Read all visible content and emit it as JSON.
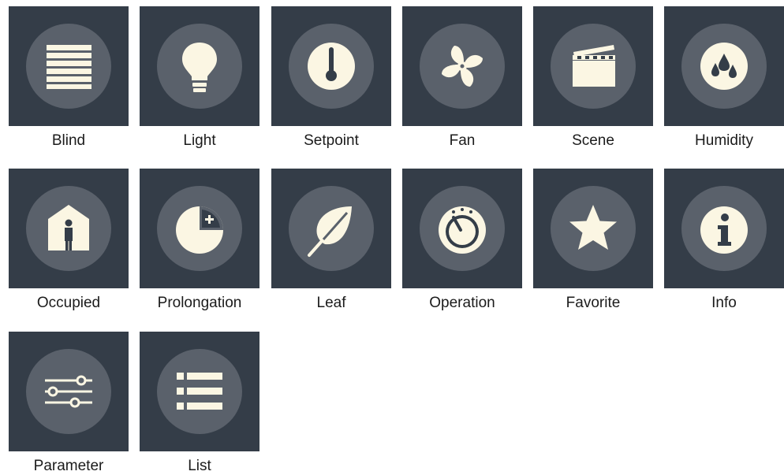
{
  "colors": {
    "tile_background": "#343d48",
    "circle_background": "#5a616b",
    "icon_fill": "#fbf6e3",
    "label_text": "#1b1b1b"
  },
  "icons": [
    {
      "label": "Blind",
      "icon": "blind-icon"
    },
    {
      "label": "Light",
      "icon": "light-bulb-icon"
    },
    {
      "label": "Setpoint",
      "icon": "thermometer-icon"
    },
    {
      "label": "Fan",
      "icon": "fan-icon"
    },
    {
      "label": "Scene",
      "icon": "clapperboard-icon"
    },
    {
      "label": "Humidity",
      "icon": "water-drops-icon"
    },
    {
      "label": "Occupied",
      "icon": "occupied-house-icon"
    },
    {
      "label": "Prolongation",
      "icon": "timer-plus-icon"
    },
    {
      "label": "Leaf",
      "icon": "leaf-icon"
    },
    {
      "label": "Operation",
      "icon": "dial-icon"
    },
    {
      "label": "Favorite",
      "icon": "star-icon"
    },
    {
      "label": "Info",
      "icon": "info-icon"
    },
    {
      "label": "Parameter",
      "icon": "sliders-icon"
    },
    {
      "label": "List",
      "icon": "list-icon"
    }
  ]
}
